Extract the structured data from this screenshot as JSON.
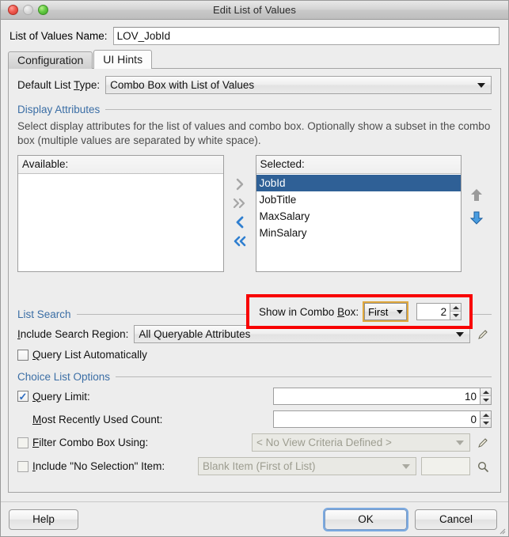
{
  "window": {
    "title": "Edit List of Values",
    "controls": [
      "close",
      "minimize",
      "zoom"
    ]
  },
  "name_row": {
    "label_pre": "List of Values ",
    "label_mnemonic": "N",
    "label_post": "ame:",
    "value": "LOV_JobId"
  },
  "tabs": [
    {
      "label": "Configuration",
      "active": false
    },
    {
      "label": "UI Hints",
      "active": true
    }
  ],
  "default_list_type": {
    "label_pre": "Default List ",
    "label_mnemonic": "T",
    "label_post": "ype:",
    "value": "Combo Box with List of Values"
  },
  "display_attributes": {
    "section_title": "Display Attributes",
    "description": "Select display attributes for the list of values and combo box. Optionally show a subset in the combo box (multiple values are separated by white space).",
    "available": {
      "header_pre": "A",
      "header_mnemonic": "v",
      "header_post": "ailable:",
      "items": []
    },
    "selected": {
      "header_pre": "",
      "header_mnemonic": "S",
      "header_post": "elected:",
      "items": [
        {
          "label": "JobId",
          "selected": true
        },
        {
          "label": "JobTitle",
          "selected": false
        },
        {
          "label": "MaxSalary",
          "selected": false
        },
        {
          "label": "MinSalary",
          "selected": false
        }
      ]
    },
    "shuttle_buttons": [
      {
        "name": "move-right",
        "glyph": "›",
        "enabled": false
      },
      {
        "name": "move-all-right",
        "glyph": "»",
        "enabled": false
      },
      {
        "name": "move-left",
        "glyph": "‹",
        "enabled": true
      },
      {
        "name": "move-all-left",
        "glyph": "«",
        "enabled": true
      }
    ],
    "order_buttons": [
      {
        "name": "move-up",
        "enabled": false
      },
      {
        "name": "move-down",
        "enabled": true
      }
    ],
    "show_in_combo": {
      "label_pre": "Show in Combo ",
      "label_mnemonic": "B",
      "label_post": "ox:",
      "mode": "First",
      "count": "2",
      "highlight_color": "#f80000",
      "focus_color": "#e0a83c"
    }
  },
  "list_search": {
    "section_title": "List Search",
    "include_search_region": {
      "label_pre": "",
      "label_mnemonic": "I",
      "label_post": "nclude Search Region:",
      "value": "All Queryable Attributes"
    },
    "query_list_automatically": {
      "label_pre": "",
      "label_mnemonic": "Q",
      "label_post": "uery List Automatically",
      "checked": false
    }
  },
  "choice_list_options": {
    "section_title": "Choice List Options",
    "query_limit": {
      "label_pre": "",
      "label_mnemonic": "Q",
      "label_post": "uery Limit:",
      "checked": true,
      "value": "10"
    },
    "mru_count": {
      "label_pre": "",
      "label_mnemonic": "M",
      "label_post": "ost Recently Used Count:",
      "value": "0"
    },
    "filter_combo_box": {
      "label_pre": "",
      "label_mnemonic": "F",
      "label_post": "ilter Combo Box Using:",
      "checked": false,
      "value": "< No View Criteria Defined >",
      "enabled": false
    },
    "include_no_selection": {
      "label_pre": "",
      "label_mnemonic": "I",
      "label_post": "nclude \"No Selection\" Item:",
      "checked": false,
      "value": "Blank Item (First of List)",
      "text_value": "",
      "enabled": false
    }
  },
  "footer": {
    "help": {
      "label_pre": "",
      "label_mnemonic": "H",
      "label_post": "elp"
    },
    "ok": {
      "label": "OK",
      "default": true
    },
    "cancel": {
      "label": "Cancel",
      "default": false
    }
  },
  "colors": {
    "selection_blue": "#2f6096",
    "section_header": "#3b6ea5",
    "highlight_red": "#f80000",
    "focus_gold": "#e0a83c",
    "default_button_blue": "#7aa9e0",
    "enabled_arrow_blue": "#2f7fd0",
    "disabled_gray": "#9a9a9a"
  }
}
